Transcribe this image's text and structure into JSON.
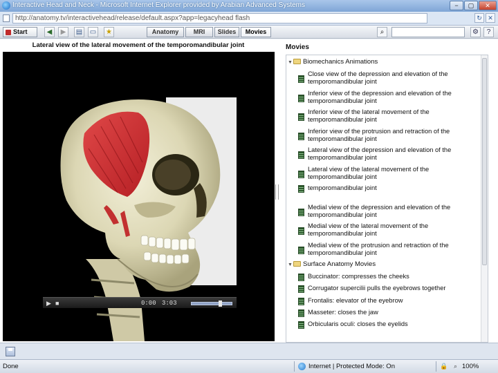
{
  "window": {
    "title": "Interactive Head and Neck - Microsoft Internet Explorer provided by Arabian Advanced Systems",
    "controls": [
      "−",
      "▢",
      "✕"
    ]
  },
  "address": {
    "url": "http://anatomy.tv/interactivehead/release/default.aspx?app=legacyhead flash"
  },
  "toolbar": {
    "start_label": "Start",
    "tabs": [
      {
        "label": "Anatomy",
        "active": false
      },
      {
        "label": "MRI",
        "active": false
      },
      {
        "label": "Slides",
        "active": false
      },
      {
        "label": "Movies",
        "active": true
      }
    ],
    "search_placeholder": ""
  },
  "video": {
    "title": "Lateral view of the lateral movement of the temporomandibular joint",
    "elapsed": "0:00",
    "duration": "3:03",
    "volume_fraction": 0.7
  },
  "movies": {
    "heading": "Movies",
    "categories": [
      {
        "label": "Biomechanics Animations",
        "items": [
          [
            "Close view of the depression and elevation of the",
            "temporomandibular joint"
          ],
          [
            "Inferior view of the depression and elevation of the",
            "temporomandibular joint"
          ],
          [
            "Inferior view of the lateral movement of the",
            "temporomandibular joint"
          ],
          [
            "Inferior view of the protrusion and retraction of the",
            "temporomandibular joint"
          ],
          [
            "Lateral view of the depression and elevation of the",
            "temporomandibular joint"
          ],
          [
            "Lateral view of the lateral movement of the",
            "temporomandibular joint"
          ],
          [
            "temporomandibular joint",
            ""
          ],
          [
            "Medial view of the depression and elevation of the",
            "temporomandibular joint"
          ],
          [
            "Medial view of the lateral movement of the",
            "temporomandibular joint"
          ],
          [
            "Medial view of the protrusion and retraction of the",
            "temporomandibular joint"
          ]
        ]
      },
      {
        "label": "Surface Anatomy Movies",
        "items": [
          [
            "Buccinator: compresses the cheeks",
            ""
          ],
          [
            "Corrugator supercilii pulls the eyebrows together",
            ""
          ],
          [
            "Frontalis: elevator of the eyebrow",
            ""
          ],
          [
            "Masseter: closes the jaw",
            ""
          ],
          [
            "Orbicularis oculi: closes the eyelids",
            ""
          ]
        ]
      }
    ]
  },
  "status": {
    "left": "Done",
    "zone": "Internet | Protected Mode: On",
    "zoom": "100%"
  }
}
